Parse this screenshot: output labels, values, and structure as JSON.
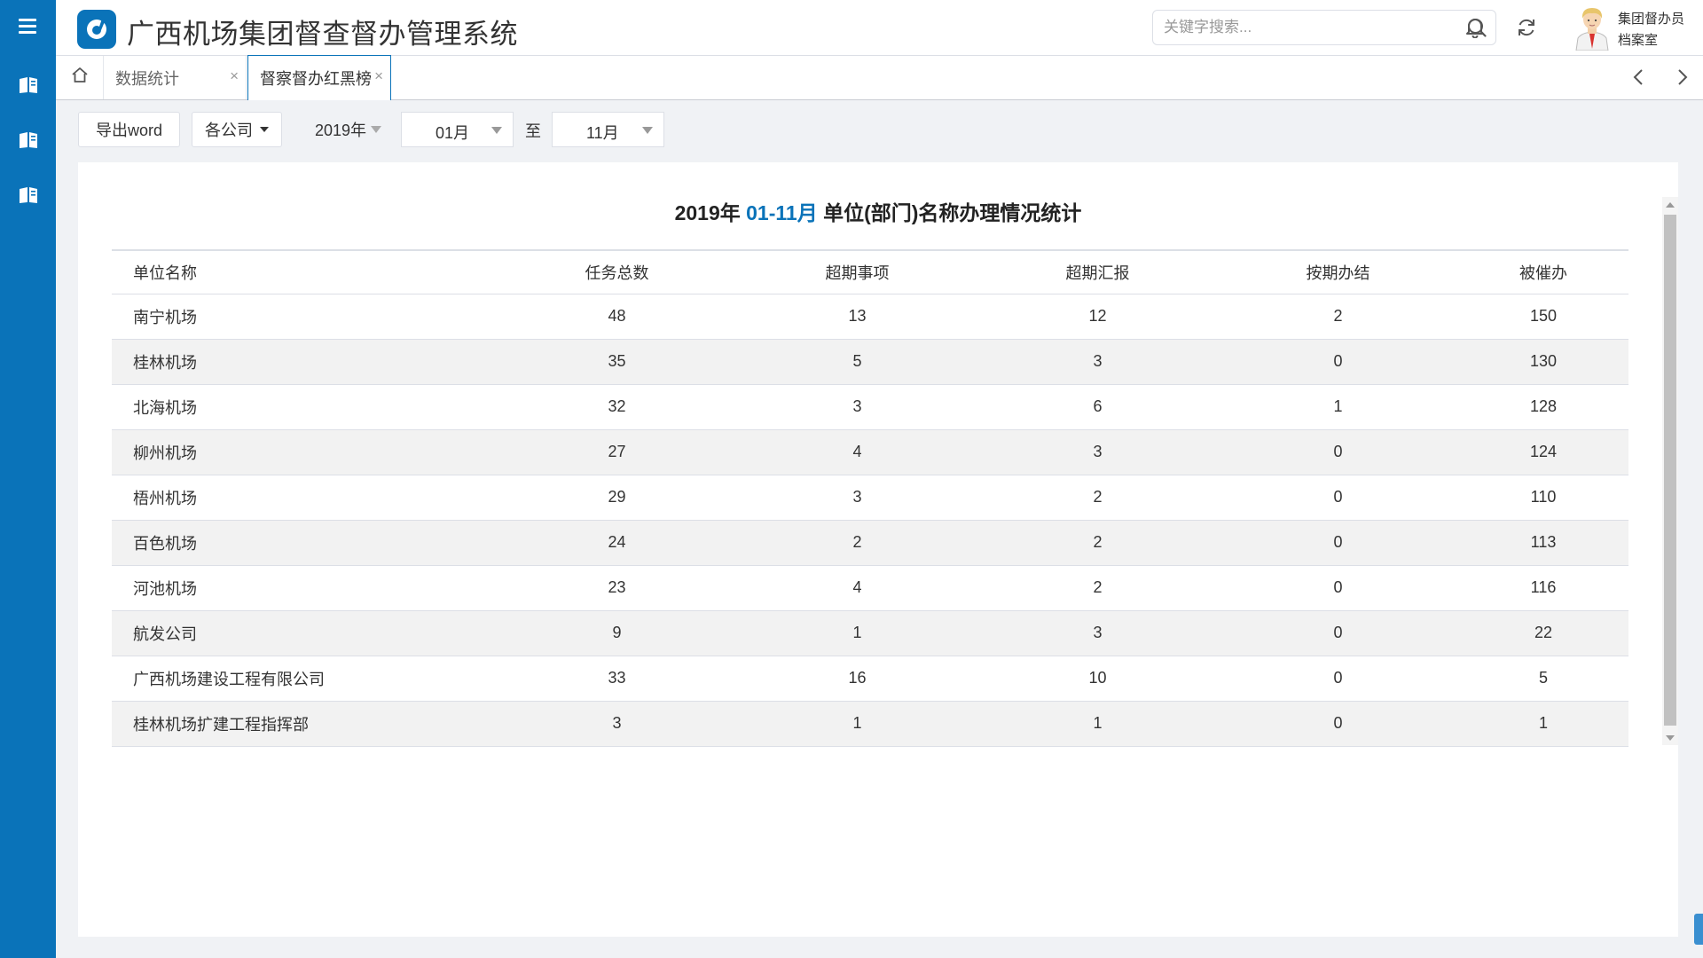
{
  "app": {
    "title": "广西机场集团督查督办管理系统",
    "brand_color": "#0a73b9"
  },
  "header": {
    "search_placeholder": "关键字搜索...",
    "user_role": "集团督办员",
    "user_dept": "档案室"
  },
  "tabs": [
    {
      "label": "数据统计",
      "active": false
    },
    {
      "label": "督察督办红黑榜",
      "active": true
    }
  ],
  "toolbar": {
    "export_label": "导出word",
    "company_label": "各公司",
    "year_label": "2019年",
    "from_month": "01月",
    "to_label": "至",
    "to_month": "11月"
  },
  "report": {
    "title_year": "2019年",
    "title_range": "01-11月",
    "title_rest": "单位(部门)名称办理情况统计",
    "columns": [
      "单位名称",
      "任务总数",
      "超期事项",
      "超期汇报",
      "按期办结",
      "被催办"
    ],
    "rows": [
      [
        "南宁机场",
        "48",
        "13",
        "12",
        "2",
        "150"
      ],
      [
        "桂林机场",
        "35",
        "5",
        "3",
        "0",
        "130"
      ],
      [
        "北海机场",
        "32",
        "3",
        "6",
        "1",
        "128"
      ],
      [
        "柳州机场",
        "27",
        "4",
        "3",
        "0",
        "124"
      ],
      [
        "梧州机场",
        "29",
        "3",
        "2",
        "0",
        "110"
      ],
      [
        "百色机场",
        "24",
        "2",
        "2",
        "0",
        "113"
      ],
      [
        "河池机场",
        "23",
        "4",
        "2",
        "0",
        "116"
      ],
      [
        "航发公司",
        "9",
        "1",
        "3",
        "0",
        "22"
      ],
      [
        "广西机场建设工程有限公司",
        "33",
        "16",
        "10",
        "0",
        "5"
      ],
      [
        "桂林机场扩建工程指挥部",
        "3",
        "1",
        "1",
        "0",
        "1"
      ]
    ]
  },
  "icons": {
    "menu": "hamburger-icon",
    "nav": [
      "book-icon",
      "book-icon",
      "book-icon"
    ],
    "search": "search-icon",
    "bell": "bell-icon",
    "refresh": "refresh-icon",
    "home": "home-icon",
    "prev": "chevron-left-icon",
    "next": "chevron-right-icon"
  }
}
